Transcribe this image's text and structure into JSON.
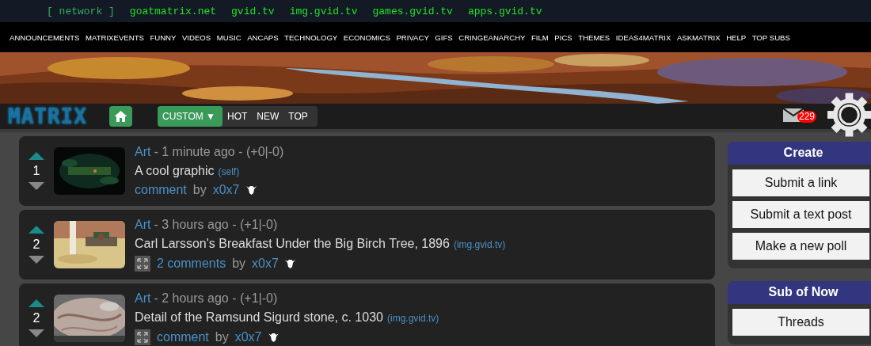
{
  "network": {
    "label": "[ network ]",
    "links": [
      "goatmatrix.net",
      "gvid.tv",
      "img.gvid.tv",
      "games.gvid.tv",
      "apps.gvid.tv"
    ]
  },
  "nav": [
    "ANNOUNCEMENTS",
    "MATRIXEVENTS",
    "FUNNY",
    "VIDEOS",
    "MUSIC",
    "ANCAPS",
    "TECHNOLOGY",
    "ECONOMICS",
    "PRIVACY",
    "GIFS",
    "CRINGEANARCHY",
    "FILM",
    "PICS",
    "THEMES",
    "IDEAS4MATRIX",
    "ASKMATRIX",
    "HELP",
    "TOP SUBS"
  ],
  "header": {
    "logo": "MATRIX",
    "tabs": [
      {
        "label": "CUSTOM ▼",
        "selected": true
      },
      {
        "label": "HOT",
        "selected": false
      },
      {
        "label": "NEW",
        "selected": false
      },
      {
        "label": "TOP",
        "selected": false
      }
    ],
    "mail_count": "229"
  },
  "posts": [
    {
      "score": "1",
      "sub": "Art",
      "meta": "- 1 minute ago - (+0|-0)",
      "title": "A cool graphic",
      "domain": "(self)",
      "comments": "comment",
      "by": "by",
      "author": "x0x7",
      "expandable": false
    },
    {
      "score": "2",
      "sub": "Art",
      "meta": "- 3 hours ago - (+1|-0)",
      "title": "Carl Larsson's Breakfast Under the Big Birch Tree, 1896",
      "domain": "(img.gvid.tv)",
      "comments": "2 comments",
      "by": "by",
      "author": "x0x7",
      "expandable": true
    },
    {
      "score": "2",
      "sub": "Art",
      "meta": "- 2 hours ago - (+1|-0)",
      "title": "Detail of the Ramsund Sigurd stone, c. 1030",
      "domain": "(img.gvid.tv)",
      "comments": "comment",
      "by": "by",
      "author": "x0x7",
      "expandable": true
    }
  ],
  "sidebar": [
    {
      "title": "Create",
      "buttons": [
        "Submit a link",
        "Submit a text post",
        "Make a new poll"
      ]
    },
    {
      "title": "Sub of Now",
      "buttons": [
        "Threads"
      ]
    }
  ]
}
